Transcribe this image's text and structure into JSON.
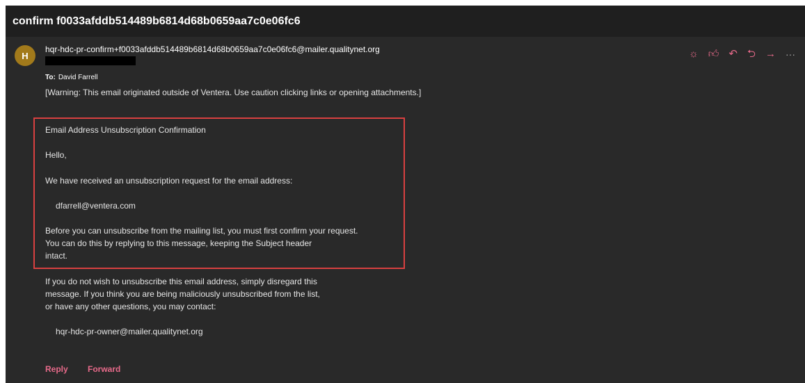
{
  "subject": "confirm f0033afddb514489b6814d68b0659aa7c0e06fc6",
  "sender": {
    "avatar_initial": "H",
    "address": "hqr-hdc-pr-confirm+f0033afddb514489b6814d68b0659aa7c0e06fc6@mailer.qualitynet.org"
  },
  "recipient": {
    "label": "To:",
    "name": "David Farrell"
  },
  "toolbar": {
    "icons": [
      "sun-icon",
      "thumbs-up-icon",
      "reply-icon",
      "reply-all-icon",
      "forward-icon",
      "more-icon"
    ]
  },
  "body": {
    "warning": "[Warning: This email originated outside of Ventera. Use caution clicking links or opening attachments.]",
    "box_title": "Email Address Unsubscription Confirmation",
    "greeting": "Hello,",
    "received": "We have received an unsubscription request for the email address:",
    "email": "dfarrell@ventera.com",
    "before1": "Before you can unsubscribe from the mailing list, you must first confirm your request.",
    "before2": "You can do this by replying to this message, keeping the Subject header",
    "before3": "intact.",
    "disregard1": "If you do not wish to unsubscribe this email address, simply disregard this",
    "disregard2": "message.  If you think you are being maliciously unsubscribed from the list,",
    "disregard3": "or have any other questions, you may contact:",
    "owner": "hqr-hdc-pr-owner@mailer.qualitynet.org"
  },
  "footer": {
    "reply": "Reply",
    "forward": "Forward"
  },
  "colors": {
    "background": "#292929",
    "accent": "#e76a8a",
    "highlight_box": "#d94040",
    "avatar": "#a27a1b"
  }
}
